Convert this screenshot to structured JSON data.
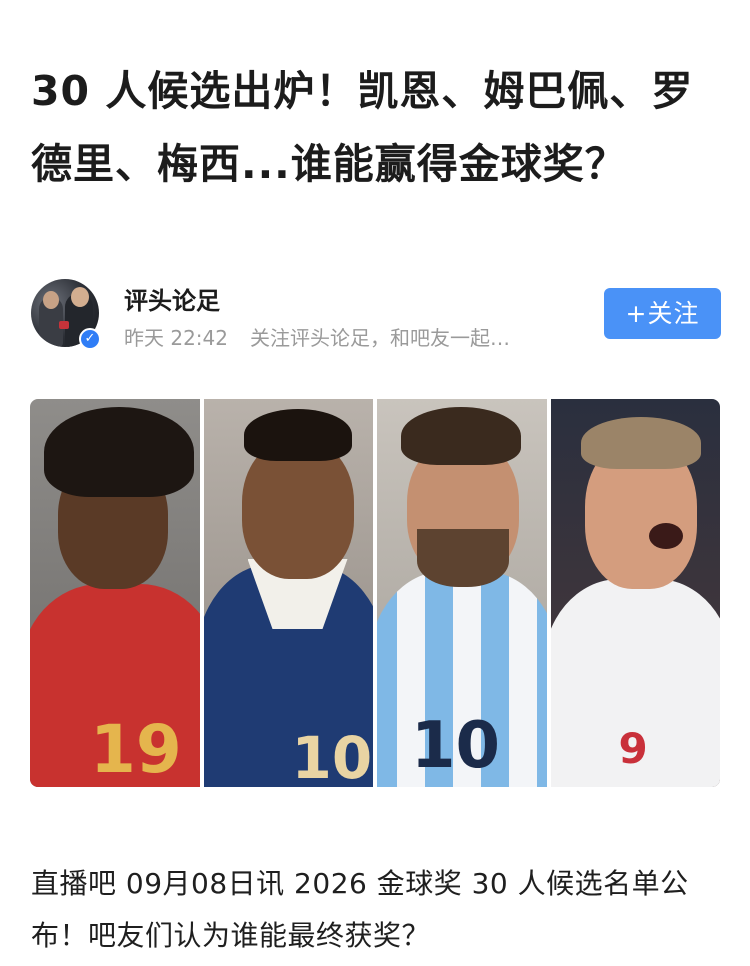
{
  "article": {
    "title": "30 人候选出炉！凯恩、姆巴佩、罗德里、梅西...谁能赢得金球奖？",
    "author": {
      "name": "评头论足",
      "time": "昨天 22:42",
      "bio": "关注评头论足，和吧友一起…",
      "follow_label": "+关注"
    },
    "hero_image": {
      "players": [
        {
          "number": "19"
        },
        {
          "number": "10"
        },
        {
          "number": "10"
        },
        {
          "number": "9"
        }
      ]
    },
    "body": "直播吧 09月08日讯 2026 金球奖 30 人候选名单公布！吧友们认为谁能最终获奖？"
  },
  "colors": {
    "follow_button": "#4a92f7",
    "verified_badge": "#2f7df6",
    "meta_text": "#9a9a9a"
  },
  "icons": {
    "verified": "verified-check-icon"
  }
}
